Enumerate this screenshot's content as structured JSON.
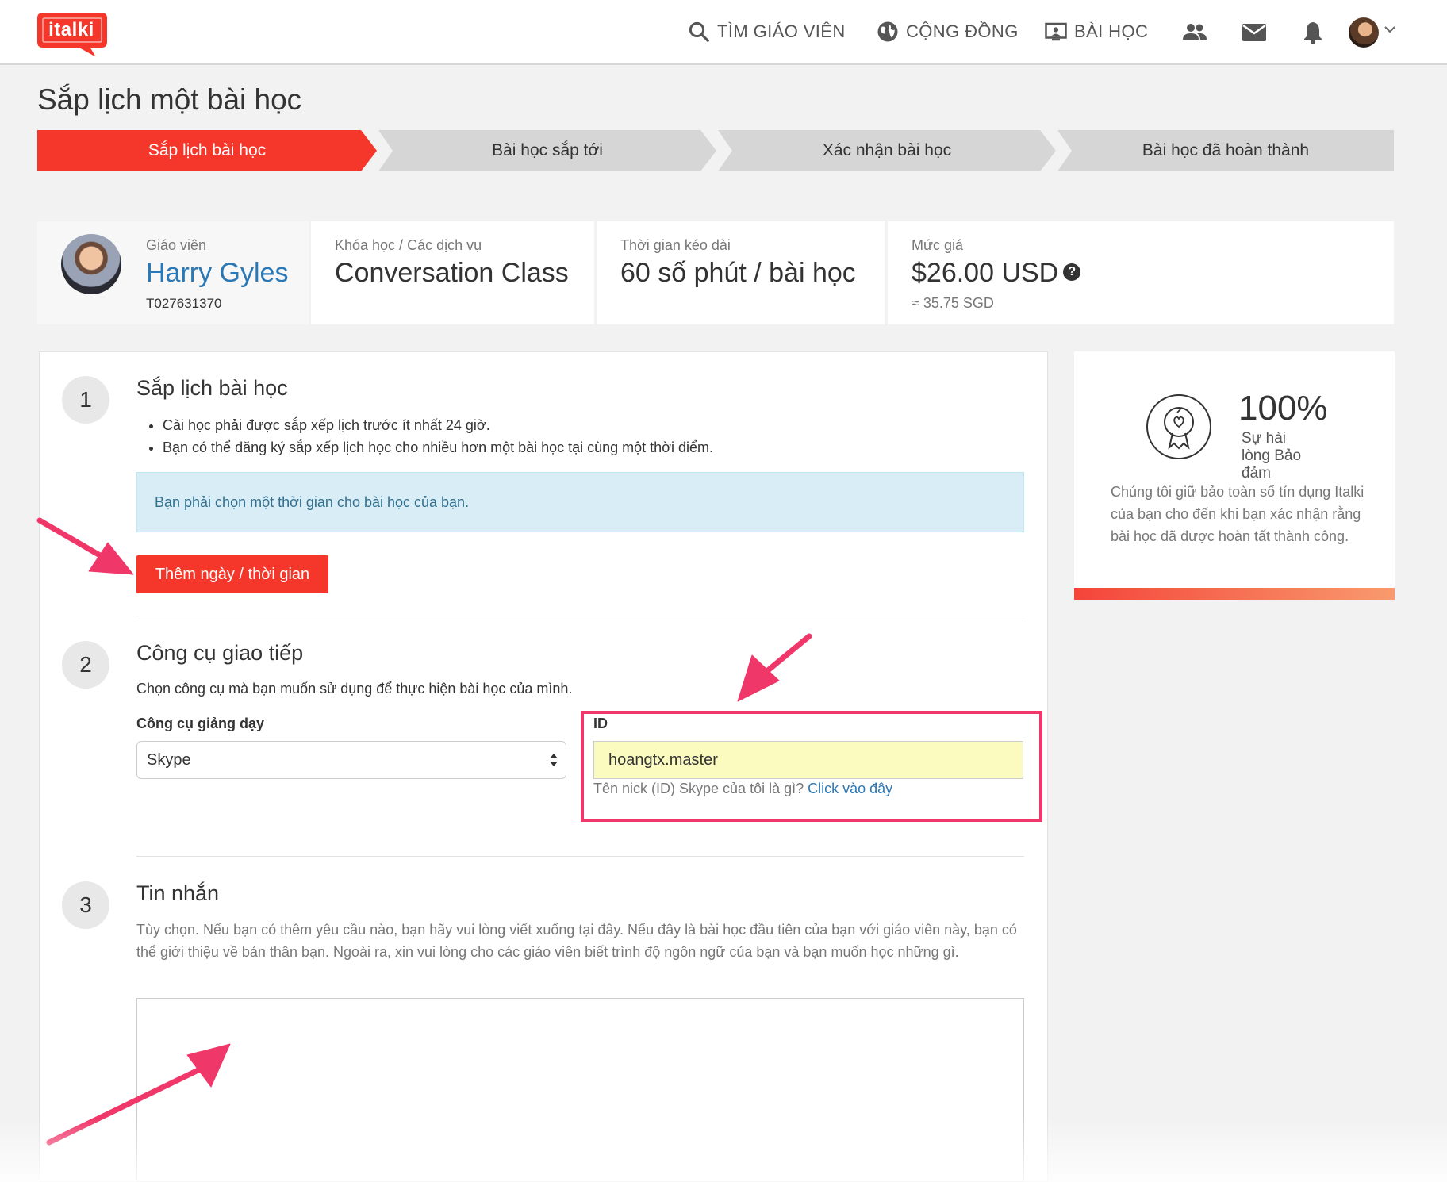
{
  "header": {
    "logo_text": "italki",
    "nav": [
      {
        "label": "TÌM GIÁO VIÊN",
        "icon": "search-icon"
      },
      {
        "label": "CỘNG ĐỒNG",
        "icon": "globe-icon"
      },
      {
        "label": "BÀI HỌC",
        "icon": "screen-icon"
      }
    ],
    "icons": [
      "people-icon",
      "mail-icon",
      "bell-icon",
      "avatar",
      "chevron-down-icon"
    ]
  },
  "page_title": "Sắp lịch một bài học",
  "steps": [
    "Sắp lịch bài học",
    "Bài học sắp tới",
    "Xác nhận bài học",
    "Bài học đã hoàn thành"
  ],
  "info": {
    "teacher_label": "Giáo viên",
    "teacher_name": "Harry Gyles",
    "teacher_id": "T027631370",
    "course_label": "Khóa học / Các dịch vụ",
    "course_value": "Conversation Class",
    "duration_label": "Thời gian kéo dài",
    "duration_value": "60 số phút / bài học",
    "price_label": "Mức giá",
    "price_value": "$26.00 USD",
    "price_help": "?",
    "price_sub": "≈ 35.75 SGD"
  },
  "section1": {
    "number": "1",
    "title": "Sắp lịch bài học",
    "bullets": [
      "Cài học phải được sắp xếp lịch trước ít nhất 24 giờ.",
      "Bạn có thể đăng ký sắp xếp lịch học cho nhiều hơn một bài học tại cùng một thời điểm."
    ],
    "alert": "Bạn phải chọn một thời gian cho bài học của bạn.",
    "add_button": "Thêm ngày / thời gian"
  },
  "section2": {
    "number": "2",
    "title": "Công cụ giao tiếp",
    "description": "Chọn công cụ mà bạn muốn sử dụng để thực hiện bài học của mình.",
    "tool_label": "Công cụ giảng dạy",
    "tool_value": "Skype",
    "id_label": "ID",
    "id_value": "hoangtx.master",
    "id_help": "Tên nick (ID) Skype của tôi là gì?",
    "id_help_link": "Click vào đây"
  },
  "section3": {
    "number": "3",
    "title": "Tin nhắn",
    "description": "Tùy chọn. Nếu bạn có thêm yêu cầu nào, bạn hãy vui lòng viết xuống tại đây. Nếu đây là bài học đầu tiên của bạn với giáo viên này, bạn có thể giới thiệu về bản thân bạn. Ngoài ra, xin vui lòng cho các giáo viên biết trình độ ngôn ngữ của bạn và bạn muốn học những gì.",
    "message_value": ""
  },
  "guarantee": {
    "percent": "100%",
    "label": "Sự hài lòng Bảo đảm",
    "text": "Chúng tôi giữ bảo toàn số tín dụng Italki của bạn cho đến khi bạn xác nhận rằng bài học đã được hoàn tất thành công."
  },
  "colors": {
    "brand_red": "#f5372b",
    "link_blue": "#2b78b6",
    "annotation_pink": "#f0376a",
    "id_input_bg": "#fbfbbf"
  }
}
